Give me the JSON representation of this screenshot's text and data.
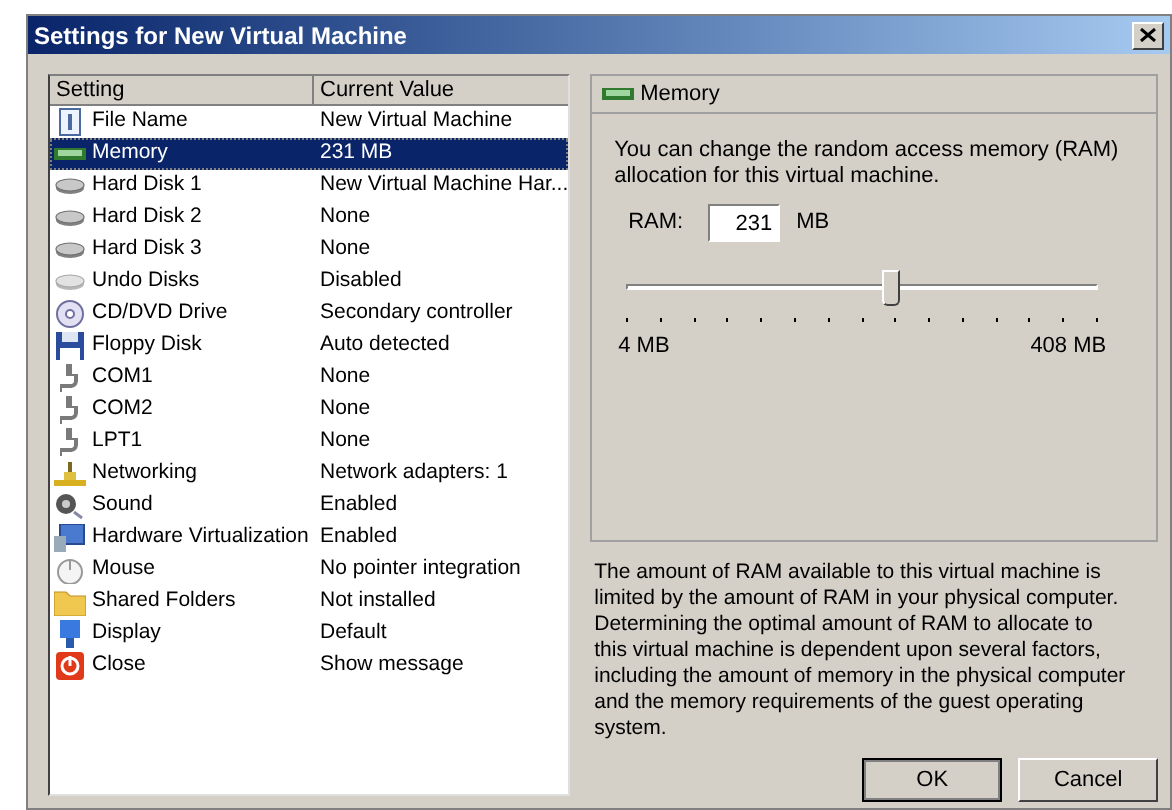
{
  "window": {
    "title": "Settings for New Virtual Machine"
  },
  "table": {
    "columns": [
      "Setting",
      "Current Value"
    ],
    "rows": [
      {
        "setting": "File Name",
        "value": "New Virtual Machine",
        "selected": false
      },
      {
        "setting": "Memory",
        "value": "231 MB",
        "selected": true
      },
      {
        "setting": "Hard Disk 1",
        "value": "New Virtual Machine Har...",
        "selected": false
      },
      {
        "setting": "Hard Disk 2",
        "value": "None",
        "selected": false
      },
      {
        "setting": "Hard Disk 3",
        "value": "None",
        "selected": false
      },
      {
        "setting": "Undo Disks",
        "value": "Disabled",
        "selected": false
      },
      {
        "setting": "CD/DVD Drive",
        "value": "Secondary controller",
        "selected": false
      },
      {
        "setting": "Floppy Disk",
        "value": "Auto detected",
        "selected": false
      },
      {
        "setting": "COM1",
        "value": "None",
        "selected": false
      },
      {
        "setting": "COM2",
        "value": "None",
        "selected": false
      },
      {
        "setting": "LPT1",
        "value": "None",
        "selected": false
      },
      {
        "setting": "Networking",
        "value": "Network adapters: 1",
        "selected": false
      },
      {
        "setting": "Sound",
        "value": "Enabled",
        "selected": false
      },
      {
        "setting": "Hardware Virtualization",
        "value": "Enabled",
        "selected": false
      },
      {
        "setting": "Mouse",
        "value": "No pointer integration",
        "selected": false
      },
      {
        "setting": "Shared Folders",
        "value": "Not installed",
        "selected": false
      },
      {
        "setting": "Display",
        "value": "Default",
        "selected": false
      },
      {
        "setting": "Close",
        "value": "Show message",
        "selected": false
      }
    ]
  },
  "panel": {
    "title": "Memory",
    "description": "You can change the random access memory (RAM) allocation for this virtual machine.",
    "ram_label": "RAM:",
    "ram_value": "231",
    "unit": "MB",
    "slider": {
      "level": 0.56,
      "min_label": "4 MB",
      "max_label": "408 MB"
    }
  },
  "note": "The amount of RAM available to this virtual machine is limited by the amount of RAM in your physical computer. Determining the optimal amount of RAM to allocate to this virtual machine is dependent upon several factors, including the amount of memory in the physical computer and the memory requirements of the guest operating system.",
  "buttons": [
    "OK",
    "Cancel"
  ]
}
